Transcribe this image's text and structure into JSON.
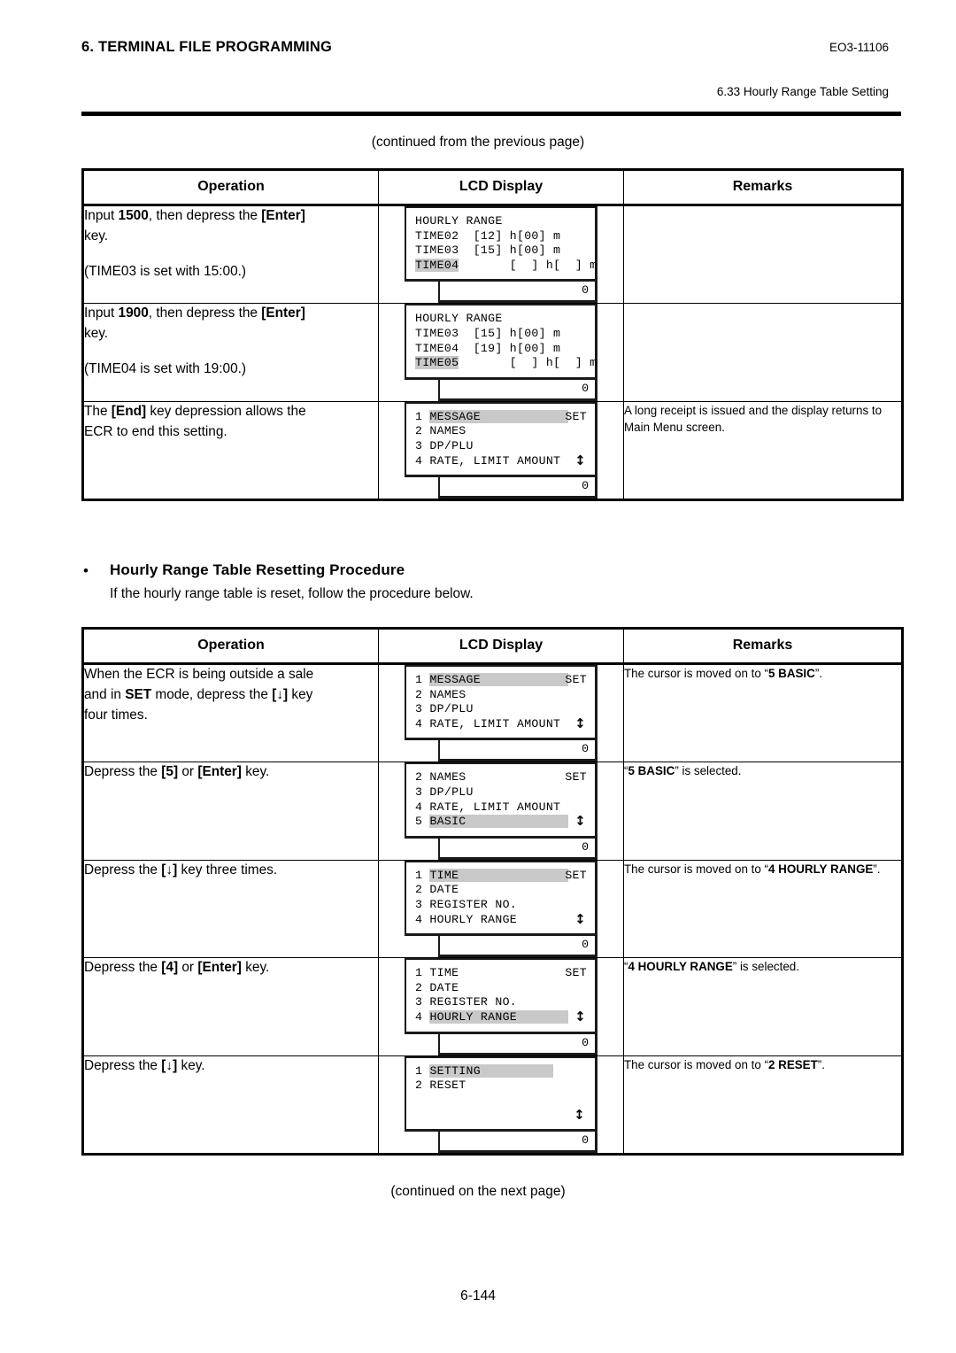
{
  "header": {
    "title": "6. TERMINAL FILE PROGRAMMING",
    "doc_code": "EO3-11106",
    "section": "6.33 Hourly Range Table Setting"
  },
  "continued_top": "(continued from the previous page)",
  "continued_bottom": "(continued on the next page)",
  "page_number": "6-144",
  "bullet": {
    "dot": "•",
    "title": "Hourly Range Table Resetting Procedure",
    "subtitle": "If the hourly range table is reset, follow the procedure below."
  },
  "columns": {
    "operation": "Operation",
    "lcd_display": "LCD Display",
    "remarks": "Remarks"
  },
  "icons": {
    "updown_arrow": "↕",
    "down_arrow": "↓"
  },
  "table1": {
    "rows": [
      {
        "operation": {
          "line1_pre": "Input ",
          "line1_bold": "1500",
          "line1_mid": ", then depress the ",
          "line1_key": "[Enter]",
          "line2": "key.",
          "line3": "(TIME03 is set with 15:00.)"
        },
        "lcd": {
          "lines": [
            {
              "text": "HOURLY RANGE"
            },
            {
              "text": "TIME02  [12] h[00] m"
            },
            {
              "text": "TIME03  [15] h[00] m"
            },
            {
              "highlight": "TIME04",
              "text": "       [  ] h[  ] m"
            }
          ],
          "value": "0"
        },
        "remarks": {
          "text": ""
        }
      },
      {
        "operation": {
          "line1_pre": "Input ",
          "line1_bold": "1900",
          "line1_mid": ", then depress the ",
          "line1_key": "[Enter]",
          "line2": "key.",
          "line3": "(TIME04 is set with 19:00.)"
        },
        "lcd": {
          "lines": [
            {
              "text": "HOURLY RANGE"
            },
            {
              "text": "TIME03  [15] h[00] m"
            },
            {
              "text": "TIME04  [19] h[00] m"
            },
            {
              "highlight": "TIME05",
              "text": "       [  ] h[  ] m"
            }
          ],
          "value": "0"
        },
        "remarks": {
          "text": ""
        }
      },
      {
        "operation": {
          "line1_pre": "The ",
          "line1_key": "[End]",
          "line1_mid": " key depression allows the",
          "line2": "ECR to end this setting."
        },
        "lcd": {
          "lines": [
            {
              "prefix": "1 ",
              "highlight": "MESSAGE            ",
              "right": "SET"
            },
            {
              "text": "2 NAMES"
            },
            {
              "text": "3 DP/PLU"
            },
            {
              "text": "4 RATE, LIMIT AMOUNT",
              "arrow": true
            }
          ],
          "value": "0"
        },
        "remarks": {
          "text": "A long receipt is issued and the display returns to Main Menu screen."
        }
      }
    ]
  },
  "table2": {
    "rows": [
      {
        "operation": {
          "line1": "When the ECR is being outside a sale",
          "line2_pre": "and in ",
          "line2_bold": "SET",
          "line2_mid": " mode, depress the ",
          "line2_key": "[↓]",
          "line2_post": " key",
          "line3": "four times."
        },
        "lcd": {
          "lines": [
            {
              "prefix": "1 ",
              "highlight": "MESSAGE            ",
              "right": "SET"
            },
            {
              "text": "2 NAMES"
            },
            {
              "text": "3 DP/PLU"
            },
            {
              "text": "4 RATE, LIMIT AMOUNT",
              "arrow": true
            }
          ],
          "value": "0"
        },
        "remarks": {
          "pre": "The cursor is moved on to “",
          "bold": "5 BASIC",
          "post": "”."
        }
      },
      {
        "operation": {
          "line1_pre": "Depress the ",
          "line1_key1": "[5]",
          "line1_mid": " or ",
          "line1_key2": "[Enter]",
          "line1_post": " key."
        },
        "lcd": {
          "lines": [
            {
              "text": "2 NAMES",
              "right": "SET"
            },
            {
              "text": "3 DP/PLU"
            },
            {
              "text": "4 RATE, LIMIT AMOUNT"
            },
            {
              "prefix": "5 ",
              "highlight": "BASIC              ",
              "arrow": true
            }
          ],
          "value": "0"
        },
        "remarks": {
          "pre": "“",
          "bold": "5 BASIC",
          "post": "” is selected."
        }
      },
      {
        "operation": {
          "line1_pre": "Depress the ",
          "line1_key1": "[↓]",
          "line1_post": " key three times."
        },
        "lcd": {
          "lines": [
            {
              "prefix": "1 ",
              "highlight": "TIME               ",
              "right": "SET"
            },
            {
              "text": "2 DATE"
            },
            {
              "text": "3 REGISTER NO."
            },
            {
              "text": "4 HOURLY RANGE",
              "arrow": true
            }
          ],
          "value": "0"
        },
        "remarks": {
          "pre": "The cursor is moved on to “",
          "bold": "4 HOURLY RANGE",
          "post": "”.",
          "justify": true
        }
      },
      {
        "operation": {
          "line1_pre": "Depress the ",
          "line1_key1": "[4]",
          "line1_mid": " or ",
          "line1_key2": "[Enter]",
          "line1_post": " key."
        },
        "lcd": {
          "lines": [
            {
              "text": "1 TIME",
              "right": "SET"
            },
            {
              "text": "2 DATE"
            },
            {
              "text": "3 REGISTER NO."
            },
            {
              "prefix": "4 ",
              "highlight": "HOURLY RANGE       ",
              "arrow": true
            }
          ],
          "value": "0"
        },
        "remarks": {
          "pre": "“",
          "bold": "4 HOURLY RANGE",
          "post": "” is selected."
        }
      },
      {
        "operation": {
          "line1_pre": "Depress the ",
          "line1_key1": "[↓]",
          "line1_post": " key."
        },
        "lcd": {
          "lines": [
            {
              "prefix": "1 ",
              "highlight": "SETTING          "
            },
            {
              "text": "2 RESET"
            },
            {
              "text": ""
            },
            {
              "text": ""
            }
          ],
          "float_arrow": true,
          "value": "0"
        },
        "remarks": {
          "pre": "The cursor is moved on to “",
          "bold": "2 RESET",
          "post": "”."
        }
      }
    ]
  }
}
